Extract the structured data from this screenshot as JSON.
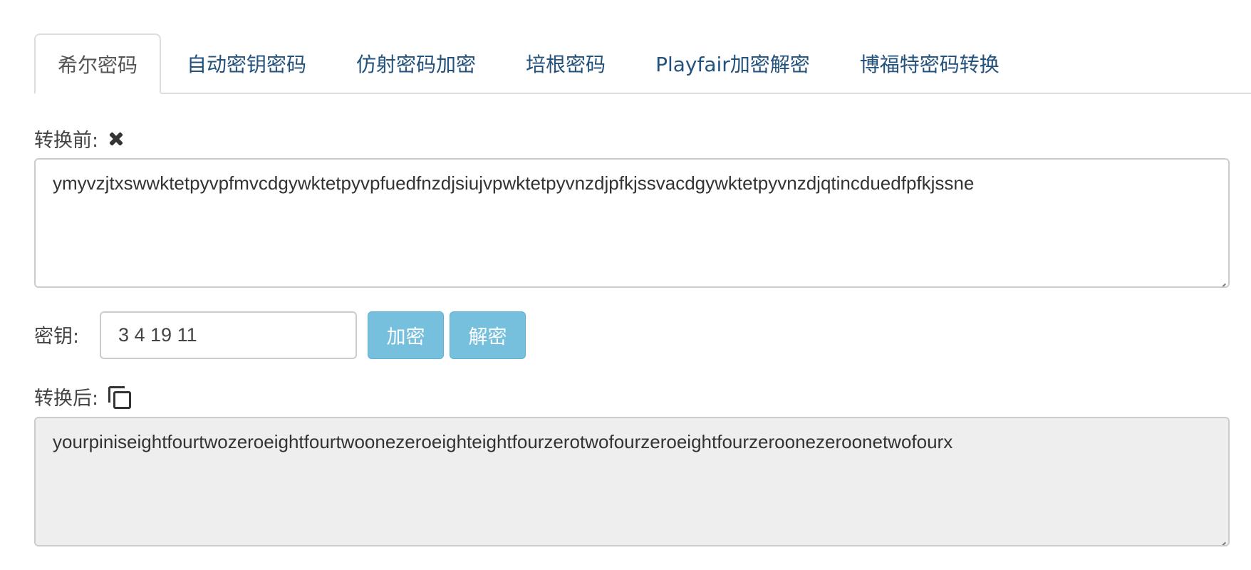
{
  "tabs": [
    {
      "label": "希尔密码",
      "active": true
    },
    {
      "label": "自动密钥密码",
      "active": false
    },
    {
      "label": "仿射密码加密",
      "active": false
    },
    {
      "label": "培根密码",
      "active": false
    },
    {
      "label": "Playfair加密解密",
      "active": false
    },
    {
      "label": "博福特密码转换",
      "active": false
    }
  ],
  "input": {
    "label": "转换前:",
    "clear_icon": "close-icon",
    "value": "ymyvzjtxswwktetpyvpfmvcdgywktetpyvpfuedfnzdjsiujvpwktetpyvnzdjpfkjssvacdgywktetpyvnzdjqtincduedfpfkjssne"
  },
  "key": {
    "label": "密钥:",
    "value": "3 4 19 11"
  },
  "buttons": {
    "encrypt": "加密",
    "decrypt": "解密"
  },
  "output": {
    "label": "转换后:",
    "copy_icon": "copy-icon",
    "value": "yourpiniseightfourtwozeroeightfourtwoonezeroeighteightfourzerotwofourzeroeightfourzeroonezeroonetwofourx"
  },
  "colors": {
    "tab_link": "#23527c",
    "button_bg": "#76c0de",
    "readonly_bg": "#eeeeee",
    "border": "#cccccc"
  }
}
